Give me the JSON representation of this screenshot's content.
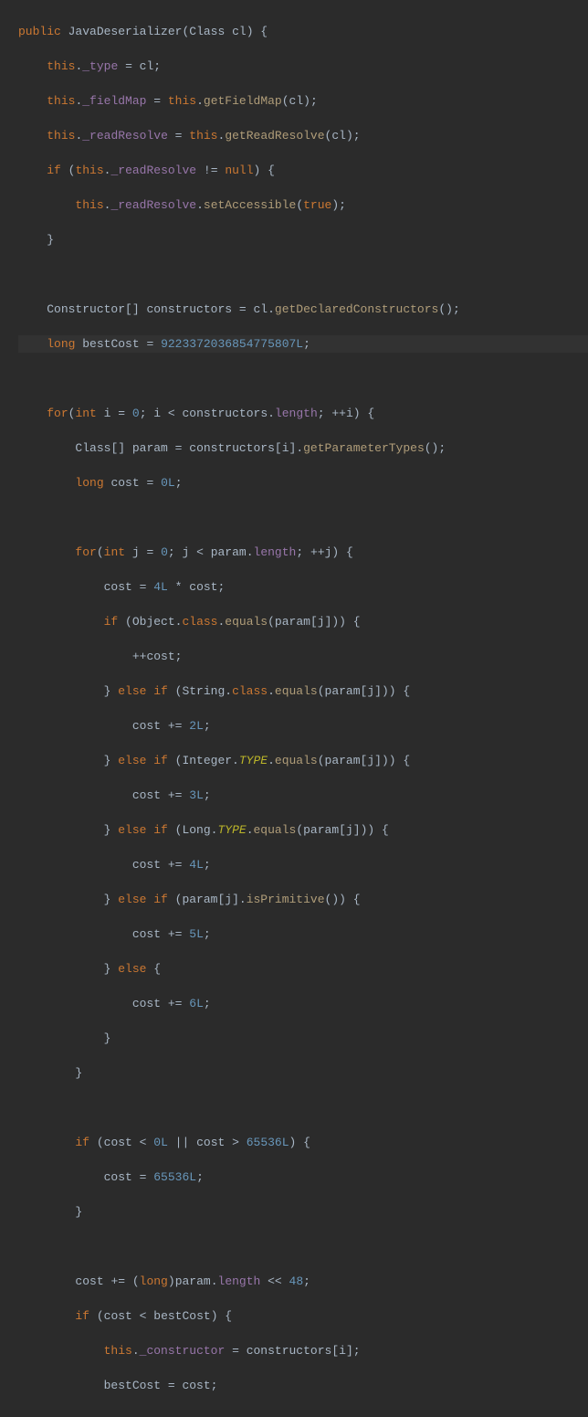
{
  "code": {
    "l1_public": "public",
    "l1_name": "JavaDeserializer",
    "l1_class": "Class",
    "l1_param": "cl",
    "l2_this": "this",
    "l2_field": "_type",
    "l2_val": "cl",
    "l3_this": "this",
    "l3_field": "_fieldMap",
    "l3_this2": "this",
    "l3_method": "getFieldMap",
    "l3_arg": "cl",
    "l4_this": "this",
    "l4_field": "_readResolve",
    "l4_this2": "this",
    "l4_method": "getReadResolve",
    "l4_arg": "cl",
    "l5_if": "if",
    "l5_this": "this",
    "l5_field": "_readResolve",
    "l5_null": "null",
    "l6_this": "this",
    "l6_field": "_readResolve",
    "l6_method": "setAccessible",
    "l6_true": "true",
    "l9_type": "Constructor",
    "l9_var": "constructors",
    "l9_obj": "cl",
    "l9_method": "getDeclaredConstructors",
    "l10_long": "long",
    "l10_var": "bestCost",
    "l10_val": "9223372036854775807L",
    "l12_for": "for",
    "l12_int": "int",
    "l12_i": "i",
    "l12_zero": "0",
    "l12_constructors": "constructors",
    "l12_length": "length",
    "l12_i2": "i",
    "l13_class": "Class",
    "l13_param": "param",
    "l13_constructors": "constructors",
    "l13_i": "i",
    "l13_method": "getParameterTypes",
    "l14_long": "long",
    "l14_cost": "cost",
    "l14_zero": "0L",
    "l16_for": "for",
    "l16_int": "int",
    "l16_j": "j",
    "l16_zero": "0",
    "l16_param": "param",
    "l16_length": "length",
    "l16_j2": "j",
    "l17_cost": "cost",
    "l17_four": "4L",
    "l17_cost2": "cost",
    "l18_if": "if",
    "l18_object": "Object",
    "l18_class": "class",
    "l18_equals": "equals",
    "l18_param": "param",
    "l18_j": "j",
    "l19_cost": "cost",
    "l20_else": "else if",
    "l20_string": "String",
    "l20_class": "class",
    "l20_equals": "equals",
    "l20_param": "param",
    "l20_j": "j",
    "l21_cost": "cost",
    "l21_val": "2L",
    "l22_else": "else if",
    "l22_integer": "Integer",
    "l22_type": "TYPE",
    "l22_equals": "equals",
    "l22_param": "param",
    "l22_j": "j",
    "l23_cost": "cost",
    "l23_val": "3L",
    "l24_else": "else if",
    "l24_long": "Long",
    "l24_type": "TYPE",
    "l24_equals": "equals",
    "l24_param": "param",
    "l24_j": "j",
    "l25_cost": "cost",
    "l25_val": "4L",
    "l26_else": "else if",
    "l26_param": "param",
    "l26_j": "j",
    "l26_method": "isPrimitive",
    "l27_cost": "cost",
    "l27_val": "5L",
    "l28_else": "else",
    "l29_cost": "cost",
    "l29_val": "6L",
    "l33_if": "if",
    "l33_cost": "cost",
    "l33_zero": "0L",
    "l33_cost2": "cost",
    "l33_big": "65536L",
    "l34_cost": "cost",
    "l34_val": "65536L",
    "l37_cost": "cost",
    "l37_long": "long",
    "l37_param": "param",
    "l37_length": "length",
    "l37_shift": "48",
    "l38_if": "if",
    "l38_cost": "cost",
    "l38_bestcost": "bestCost",
    "l39_this": "this",
    "l39_field": "_constructor",
    "l39_constructors": "constructors",
    "l39_i": "i",
    "l40_bestcost": "bestCost",
    "l40_cost": "cost"
  }
}
